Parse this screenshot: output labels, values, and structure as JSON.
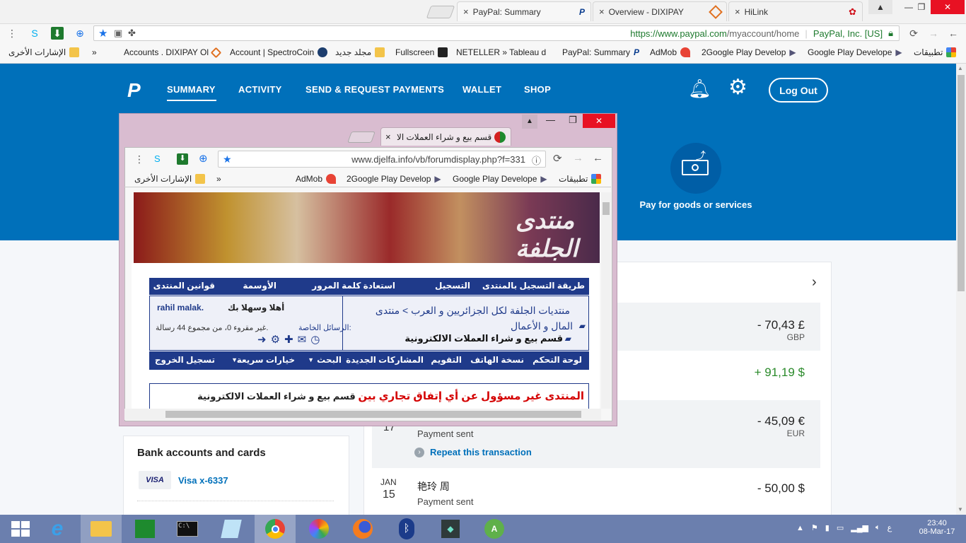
{
  "browser": {
    "tabs": [
      {
        "label": "PayPal: Summary",
        "active": true
      },
      {
        "label": "Overview - DIXIPAY",
        "active": false
      },
      {
        "label": "HiLink",
        "active": false
      }
    ],
    "url_domain": "https://www.paypal.com",
    "url_path": "/myaccount/home",
    "security_label": "PayPal, Inc. [US]",
    "bookmarks": [
      "تطبيقات",
      "Google Play Develope",
      "2Google Play Develop",
      "AdMob",
      "PayPal: Summary",
      "NETELLER » Tableau d",
      "Fullscreen",
      "مجلد جديد",
      "Account | SpectroCoin",
      "Accounts . DIXIPAY Ol"
    ],
    "more_bookmarks": "»",
    "other_bookmarks": "الإشارات الأخرى"
  },
  "paypal": {
    "nav": [
      "SUMMARY",
      "ACTIVITY",
      "SEND & REQUEST PAYMENTS",
      "WALLET",
      "SHOP"
    ],
    "logout": "Log Out",
    "pay_label": "Pay for goods or services",
    "bank_title": "Bank accounts and cards",
    "visa_badge": "VISA",
    "visa_label": "Visa x-6337",
    "transactions": [
      {
        "amount": "- 70,43 £",
        "currency": "GBP"
      },
      {
        "amount": "+ 91,19 $",
        "currency": ""
      },
      {
        "date_month": "",
        "date_day": "17",
        "name": "",
        "status": "Payment sent",
        "repeat": "Repeat this transaction",
        "amount": "- 45,09 €",
        "currency": "EUR"
      },
      {
        "date_month": "JAN",
        "date_day": "15",
        "name": "艳玲 周",
        "status": "Payment sent",
        "amount": "- 50,00 $",
        "currency": ""
      }
    ],
    "colors": {
      "brand": "#0070ba",
      "positive": "#2a8a2a",
      "link": "#0070ba"
    }
  },
  "popup": {
    "tab_title": "قسم بيع و شراء العملات الا",
    "url": "www.djelfa.info/vb/forumdisplay.php?f=331",
    "bookmarks": [
      "تطبيقات",
      "Google Play Develope",
      "2Google Play Develop",
      "AdMob"
    ],
    "more_bookmarks": "»",
    "other_bookmarks": "الإشارات الأخرى",
    "forum": {
      "top_nav": [
        "طريقة التسجيل بالمنتدى",
        "التسجيل",
        "استعادة كلمة المرور",
        "الأوسمة",
        "قوانين المنتدى"
      ],
      "breadcrumb_1": "منتديات الجلفة لكل الجزائريين و العرب > منتدى",
      "breadcrumb_2": "المال و الأعمال",
      "breadcrumb_3": "قسم بيع و شراء العملات الالكترونية",
      "welcome_prefix": "أهلا وسهلا بك",
      "username": "rahil malak.",
      "pm_label": "الرسائل الخاصة:",
      "pm_text": "غير مقروء 0، من مجموع 44 رسالة.",
      "bottom_nav": [
        "لوحة التحكم",
        "نسخة الهاتف",
        "التقويم",
        "المشاركات الجديدة",
        "البحث",
        "خيارات سريعة",
        "تسجيل الخروج"
      ],
      "notice_prefix": "قسم بيع و شراء العملات الالكترونية",
      "notice_red": "المنتدى غير مسؤول عن أي إتفاق تجاري بين"
    }
  },
  "taskbar": {
    "lang": "ع",
    "time": "23:40",
    "date": "08-Mar-17"
  }
}
